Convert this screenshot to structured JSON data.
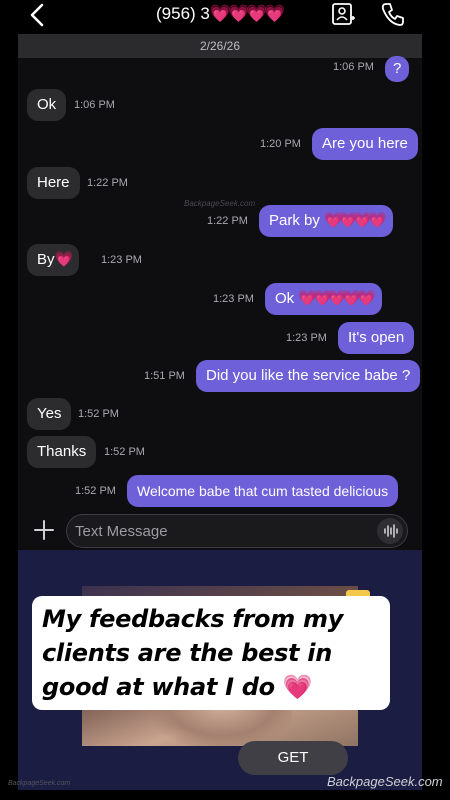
{
  "header": {
    "title_prefix": "(956) 3",
    "title_hearts": "💗💗💗💗",
    "back_icon": "chevron-left-icon",
    "add_contact_icon": "add-contact-icon",
    "call_icon": "phone-icon"
  },
  "chat": {
    "date": "2/26/26",
    "watermark": "BackpageSeek.com",
    "messages": [
      {
        "dir": "out",
        "text": "?",
        "time": "1:06 PM"
      },
      {
        "dir": "in",
        "text": "Ok",
        "time": "1:06 PM"
      },
      {
        "dir": "out",
        "text": "Are you here",
        "time": "1:20 PM"
      },
      {
        "dir": "in",
        "text": "Here",
        "time": "1:22 PM"
      },
      {
        "dir": "out",
        "text": "Park by ",
        "emoji": "💗💗💗💗",
        "time": "1:22 PM"
      },
      {
        "dir": "in",
        "text": "By",
        "emoji": "💗",
        "time": "1:23 PM"
      },
      {
        "dir": "out",
        "text": "Ok ",
        "emoji": "💗💗💗💗💗",
        "time": "1:23 PM"
      },
      {
        "dir": "out",
        "text": "It's open",
        "time": "1:23 PM"
      },
      {
        "dir": "out",
        "text": "Did you like the service babe ?",
        "time": "1:51 PM"
      },
      {
        "dir": "in",
        "text": "Yes",
        "time": "1:52 PM"
      },
      {
        "dir": "in",
        "text": "Thanks",
        "time": "1:52 PM"
      },
      {
        "dir": "out",
        "text": "Welcome babe that cum tasted delicious",
        "time": "1:52 PM"
      }
    ]
  },
  "composer": {
    "placeholder": "Text Message",
    "plus_icon": "plus-icon",
    "voice_icon": "voice-wave-icon"
  },
  "promo": {
    "feedback_text": "My feedbacks from my clients are the best in good at what I do",
    "feedback_emoji": "💗",
    "get_label": "GET"
  },
  "footer": {
    "watermark": "BackpageSeek.com",
    "watermark_small": "BackpageSeek.com"
  },
  "colors": {
    "outgoing_bubble": "#6e60d8",
    "incoming_bubble": "#2c2c2e",
    "heart": "#ff4fc8"
  }
}
